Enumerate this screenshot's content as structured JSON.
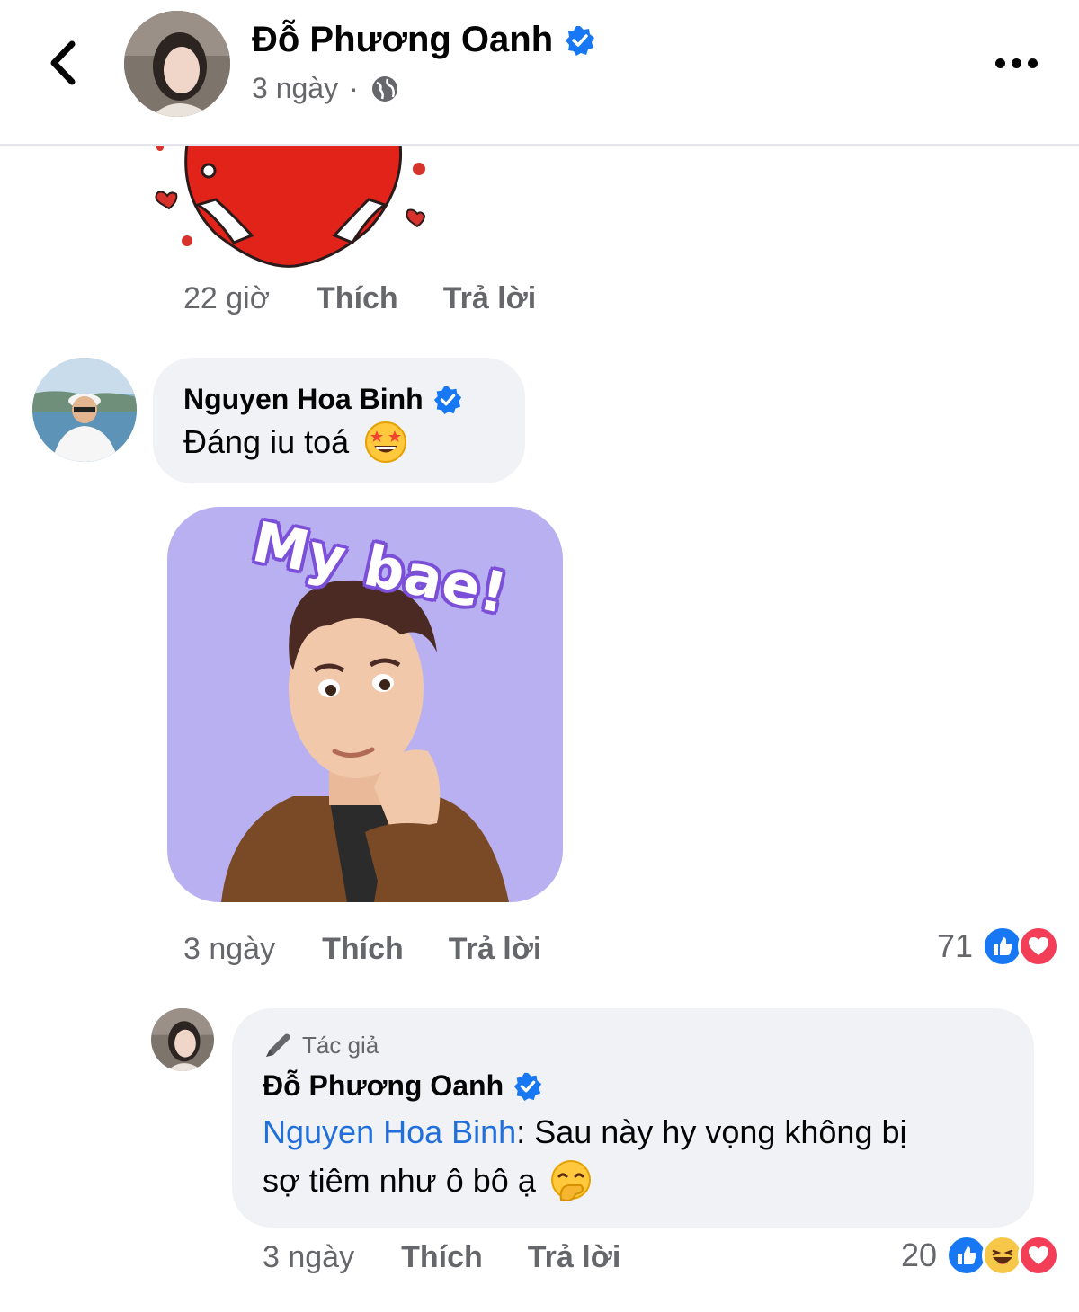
{
  "header": {
    "title": "Đỗ Phương Oanh",
    "timestamp": "3 ngày",
    "separator": "·"
  },
  "comments": [
    {
      "time": "22 giờ",
      "like_label": "Thích",
      "reply_label": "Trả lời"
    },
    {
      "author": "Nguyen Hoa Binh",
      "text": "Đáng iu toá",
      "sticker_text": "My bae!",
      "time": "3 ngày",
      "like_label": "Thích",
      "reply_label": "Trả lời",
      "reaction_count": "71"
    },
    {
      "badge": "Tác giả",
      "author": "Đỗ Phương Oanh",
      "mention": "Nguyen Hoa Binh",
      "text_after_mention": ": Sau này hy vọng không bị",
      "text_line2": "sợ tiêm như ô bô ạ",
      "time": "3 ngày",
      "like_label": "Thích",
      "reply_label": "Trả lời",
      "reaction_count": "20"
    }
  ],
  "colors": {
    "verified": "#1877f2",
    "like": "#1877f2",
    "love": "#f33e58",
    "bubble": "#f0f2f5",
    "secondary_text": "#65676b",
    "mention": "#216fdb",
    "sticker_bg": "#b9b0f2"
  },
  "icons": [
    "back-icon",
    "verified-icon",
    "globe-icon",
    "more-icon",
    "like-icon",
    "love-icon",
    "haha-icon",
    "pen-icon"
  ]
}
